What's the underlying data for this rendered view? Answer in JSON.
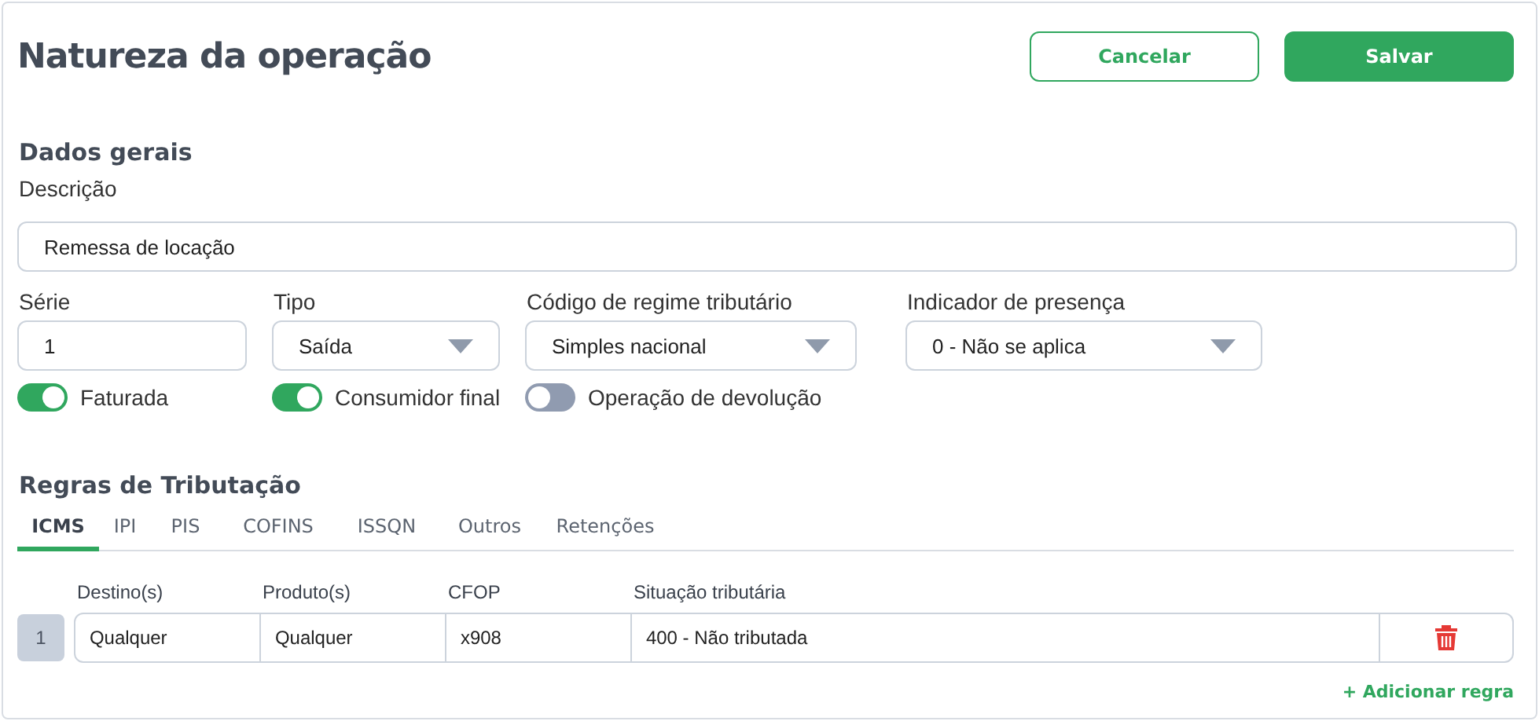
{
  "header": {
    "title": "Natureza da operação",
    "buttons": [
      {
        "label": "Cancelar",
        "kind": "secondary"
      },
      {
        "label": "Salvar",
        "kind": "primary"
      }
    ]
  },
  "general": {
    "heading": "Dados gerais",
    "description": {
      "label": "Descrição",
      "value": "Remessa de locação"
    },
    "fields": [
      {
        "label": "Série",
        "kind": "text",
        "value": "1"
      },
      {
        "label": "Tipo",
        "kind": "select",
        "value": "Saída"
      },
      {
        "label": "Código de regime tributário",
        "kind": "select",
        "value": "Simples nacional"
      },
      {
        "label": "Indicador de presença",
        "kind": "select",
        "value": "0 - Não se aplica"
      }
    ],
    "toggles": [
      {
        "label": "Faturada",
        "on": true
      },
      {
        "label": "Consumidor final",
        "on": true
      },
      {
        "label": "Operação de devolução",
        "on": false
      }
    ]
  },
  "rules": {
    "heading": "Regras de Tributação",
    "tabs": [
      {
        "label": "ICMS",
        "selected": true
      },
      {
        "label": "IPI",
        "selected": false
      },
      {
        "label": "PIS",
        "selected": false
      },
      {
        "label": "COFINS",
        "selected": false
      },
      {
        "label": "ISSQN",
        "selected": false
      },
      {
        "label": "Outros",
        "selected": false
      },
      {
        "label": "Retenções",
        "selected": false
      }
    ],
    "columns": [
      "Destino(s)",
      "Produto(s)",
      "CFOP",
      "Situação tributária"
    ],
    "rows": [
      {
        "number": "1",
        "cells": [
          "Qualquer",
          "Qualquer",
          "x908",
          "400 - Não tributada"
        ]
      }
    ],
    "add_link": "+ Adicionar regra"
  }
}
